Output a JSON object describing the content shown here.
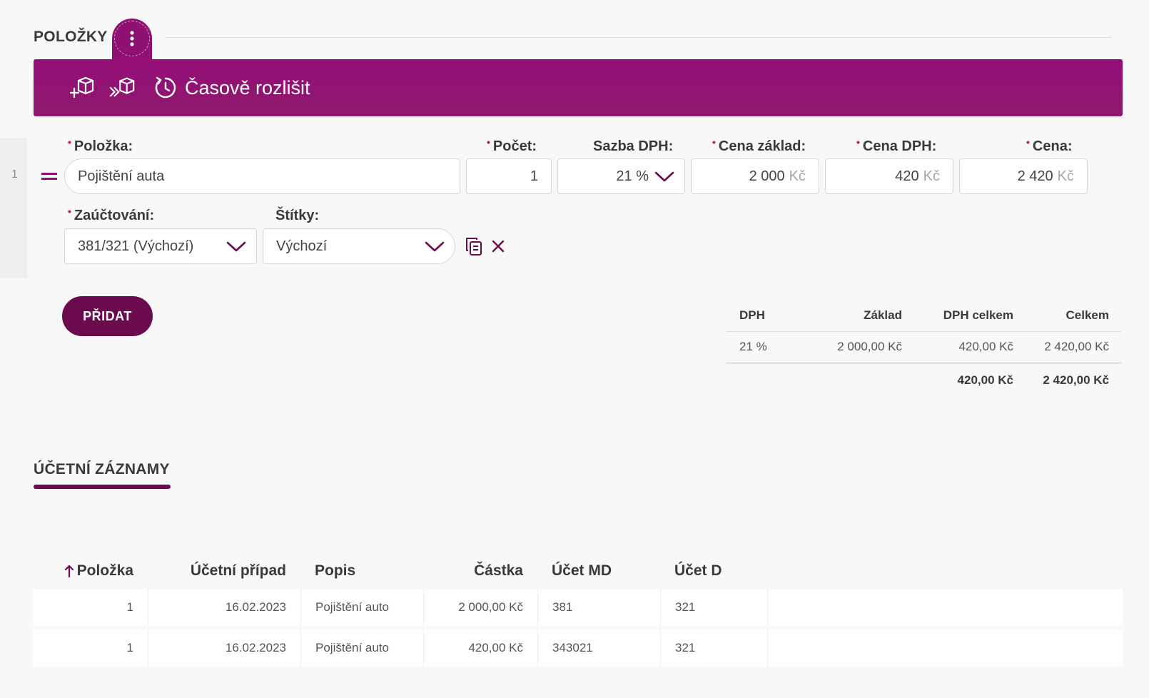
{
  "items_section": {
    "title": "POLOŽKY"
  },
  "toolbar": {
    "time_resolve_label": "Časově rozlišit"
  },
  "item_row": {
    "row_number": "1",
    "labels": {
      "item": "Položka:",
      "count": "Počet:",
      "vat_rate": "Sazba DPH:",
      "base_price": "Cena základ:",
      "vat_price": "Cena DPH:",
      "price": "Cena:",
      "accounting": "Zaúčtování:",
      "tags": "Štítky:"
    },
    "required_mark": "•",
    "values": {
      "item": "Pojištění auta",
      "count": "1",
      "vat_rate": "21 %",
      "base_price": "2 000",
      "vat_price": "420",
      "price": "2 420",
      "currency": "Kč",
      "accounting": "381/321 (Výchozí)",
      "tags": "Výchozí"
    }
  },
  "add_button": {
    "label": "PŘIDAT"
  },
  "vat_summary": {
    "headers": [
      "DPH",
      "Základ",
      "DPH celkem",
      "Celkem"
    ],
    "rows": [
      [
        "21 %",
        "2 000,00 Kč",
        "420,00 Kč",
        "2 420,00 Kč"
      ]
    ],
    "totals": [
      "",
      "",
      "420,00 Kč",
      "2 420,00 Kč"
    ]
  },
  "accounting_section": {
    "title": "ÚČETNÍ ZÁZNAMY"
  },
  "records_table": {
    "headers": [
      "Položka",
      "Účetní případ",
      "Popis",
      "Částka",
      "Účet MD",
      "Účet D"
    ],
    "rows": [
      [
        "1",
        "16.02.2023",
        "Pojištění auto",
        "2 000,00 Kč",
        "381",
        "321"
      ],
      [
        "1",
        "16.02.2023",
        "Pojištění auto",
        "420,00 Kč",
        "343021",
        "321"
      ]
    ]
  },
  "colors": {
    "brand": "#950d78",
    "brand_dark": "#6b0a4c",
    "required": "#c8124b"
  }
}
